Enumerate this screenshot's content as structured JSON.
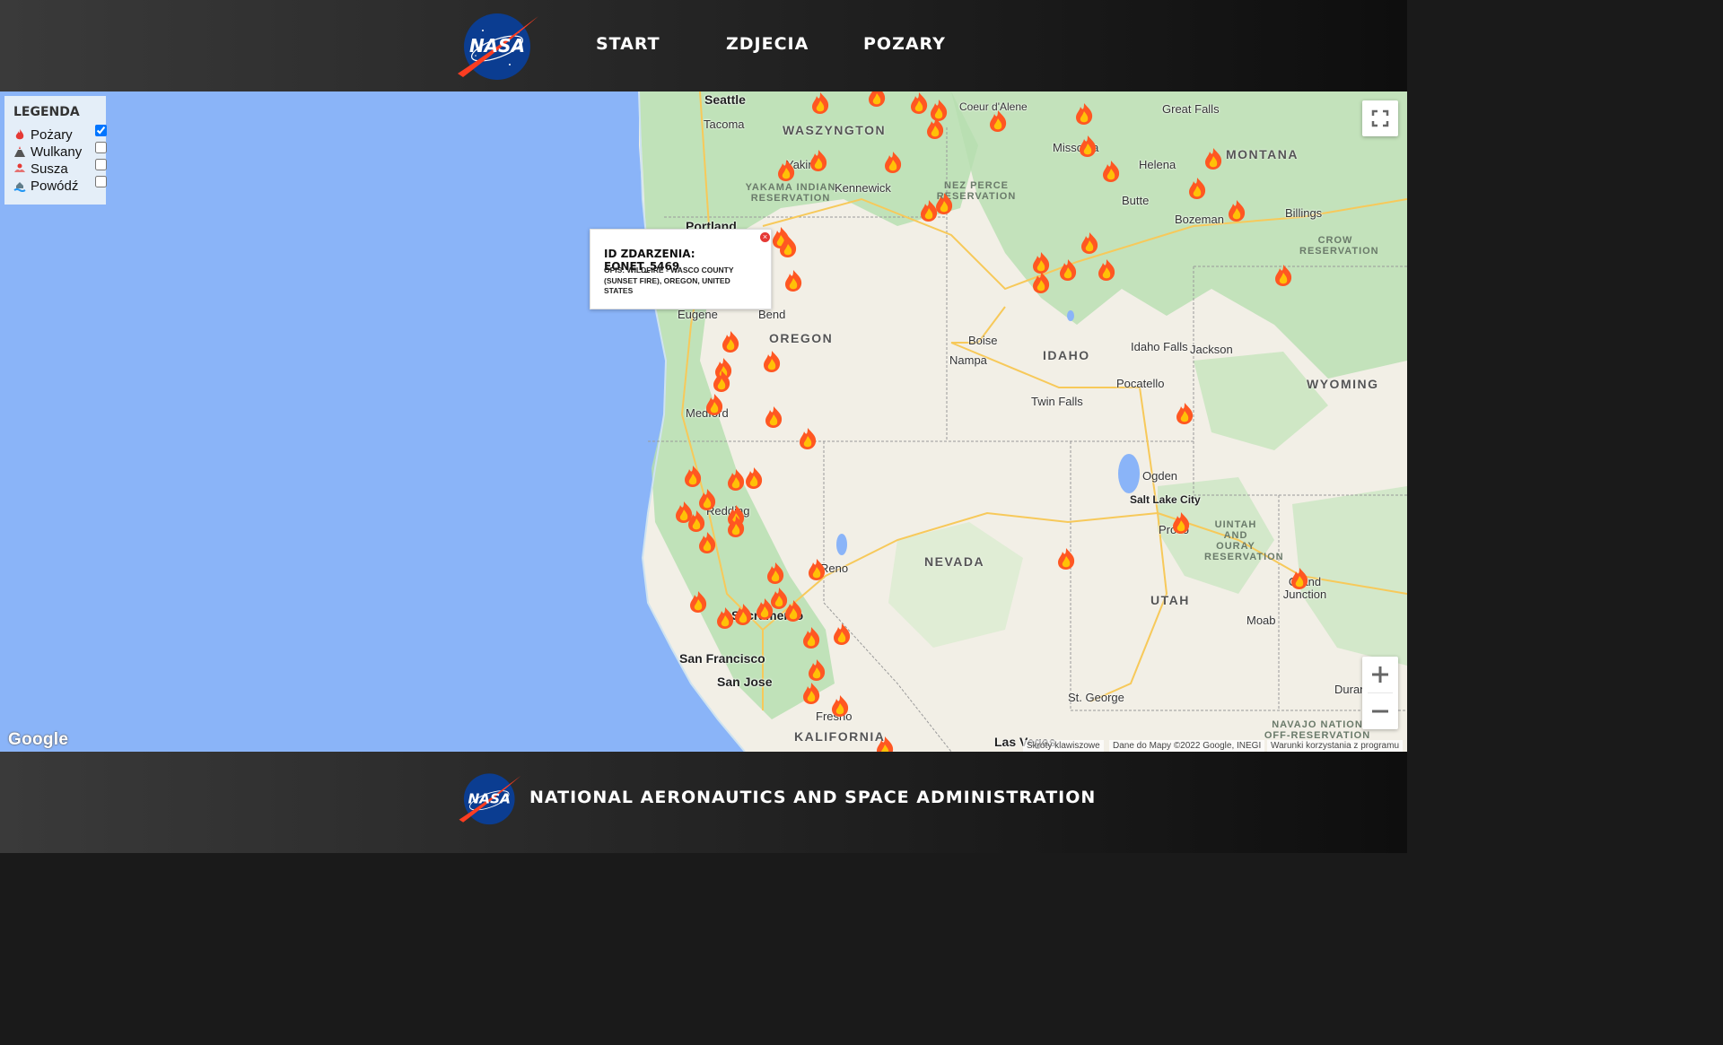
{
  "header": {
    "nav": [
      "START",
      "ZDJECIA",
      "POZARY"
    ]
  },
  "legend": {
    "title": "LEGENDA",
    "items": [
      {
        "label": "Pożary",
        "icon": "fire-icon",
        "checked": true
      },
      {
        "label": "Wulkany",
        "icon": "volcano-icon",
        "checked": false
      },
      {
        "label": "Susza",
        "icon": "drought-icon",
        "checked": false
      },
      {
        "label": "Powódź",
        "icon": "flood-icon",
        "checked": false
      }
    ]
  },
  "popup": {
    "title": "ID ZDARZENIA: EONET_5469",
    "description": "OPIS: WILDFIRE - WASCO COUNTY (SUNSET FIRE), OREGON, UNITED STATES",
    "close": "×"
  },
  "map": {
    "cities": [
      "Seattle",
      "Tacoma",
      "Yakima",
      "Kennewick",
      "Portland",
      "Eugene",
      "Bend",
      "Medford",
      "Redding",
      "Sacramento",
      "Reno",
      "San Francisco",
      "San Jose",
      "Fresno",
      "Las Vegas",
      "Boise",
      "Nampa",
      "Twin Falls",
      "Pocatello",
      "Idaho Falls",
      "Jackson",
      "Ogden",
      "Salt Lake City",
      "Provo",
      "Moab",
      "Grand Junction",
      "St. George",
      "Durango",
      "Coeur d'Alene",
      "Missoula",
      "Helena",
      "Great Falls",
      "Butte",
      "Bozeman",
      "Billings"
    ],
    "states": [
      "WASZYNGTON",
      "OREGON",
      "IDAHO",
      "MONTANA",
      "WYOMING",
      "NEVADA",
      "UTAH",
      "KALIFORNIA"
    ],
    "reservations": [
      "YAKAMA INDIAN RESERVATION",
      "NEZ PERCE RESERVATION",
      "CROW RESERVATION",
      "UINTAH AND OURAY RESERVATION",
      "NAVAJO NATION OFF-RESERVATION"
    ],
    "attribution": {
      "shortcuts": "Skróty klawiszowe",
      "data": "Dane do Mapy ©2022 Google, INEGI",
      "terms": "Warunki korzystania z programu"
    },
    "google_logo": "Google",
    "marker_icon": "fire-icon",
    "colors": {
      "ocean": "#8ab4f8",
      "land": "#f2efe6",
      "forest": "#b7dfb0",
      "fire": "#ff5722"
    }
  },
  "footer": {
    "text": "NATIONAL AERONAUTICS AND SPACE ADMINISTRATION"
  }
}
